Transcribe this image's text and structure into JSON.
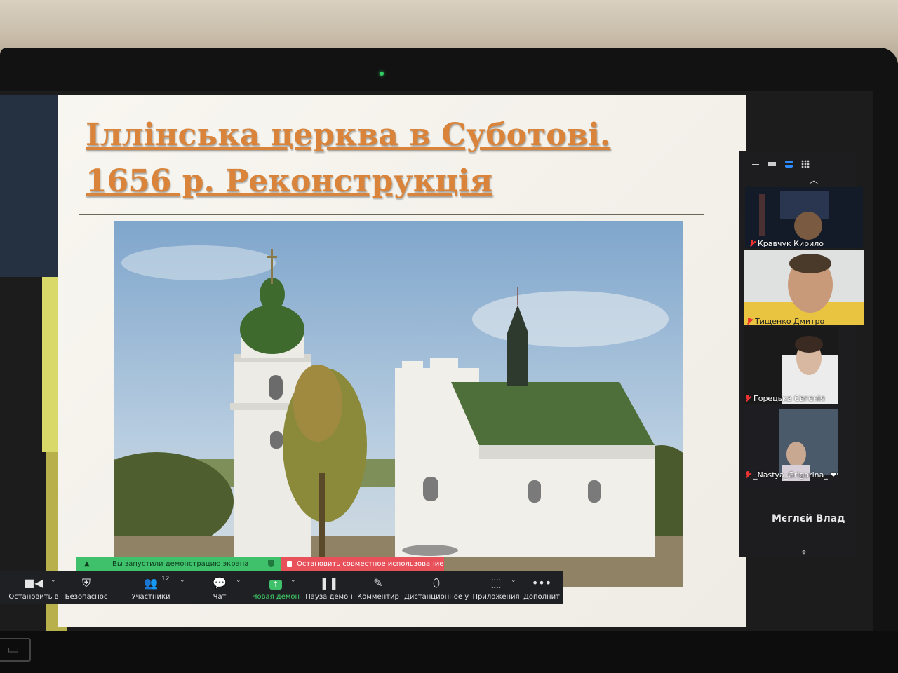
{
  "slide": {
    "title_line1": "Іллінська церква в Суботові.",
    "title_line2": "1656 р. Реконструкція"
  },
  "participants": [
    {
      "name": "Кравчук Кирило",
      "muted": true
    },
    {
      "name": "Тищенко Дмитро",
      "muted": true
    },
    {
      "name": "Горецька Євгенія",
      "muted": true
    },
    {
      "name": "_Nastya_Grigorina_ ❤❤❤",
      "muted": true
    }
  ],
  "active_speaker": "Мєглєй Влад",
  "share_banner": {
    "started_text": "Вы запустили демонстрацию экрана",
    "stop_text": "Остановить совместное использование"
  },
  "toolbar": {
    "stop_video": "Остановить в",
    "security": "Безопаснос",
    "participants": "Участники",
    "participants_count": "12",
    "chat": "Чат",
    "new_share": "Новая демон",
    "pause_share": "Пауза демон",
    "annotate": "Комментир",
    "remote_control": "Дистанционное у",
    "apps": "Приложения",
    "more": "Дополнит"
  },
  "colors": {
    "title": "#d9843a",
    "share_green": "#3fc06a",
    "share_red": "#e8505a",
    "toolbar_bg": "#1f2023"
  }
}
